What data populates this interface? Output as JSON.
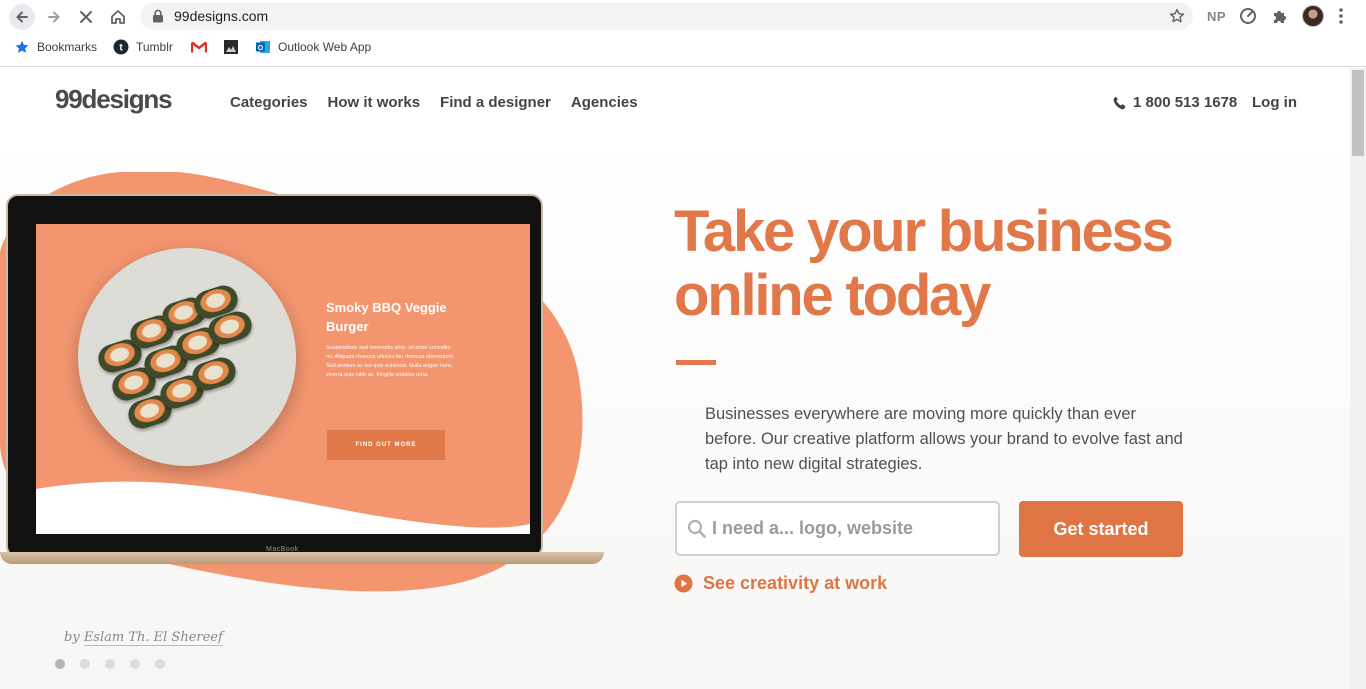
{
  "browser": {
    "url": "99designs.com",
    "profile_initials": "NP",
    "bookmarks": [
      {
        "label": "Bookmarks",
        "icon": "star-icon"
      },
      {
        "label": "Tumblr",
        "icon": "tumblr-icon"
      },
      {
        "label": "",
        "icon": "gmail-icon"
      },
      {
        "label": "",
        "icon": "image-icon"
      },
      {
        "label": "Outlook Web App",
        "icon": "outlook-icon"
      }
    ]
  },
  "site": {
    "logo": "99designs",
    "nav": [
      "Categories",
      "How it works",
      "Find a designer",
      "Agencies"
    ],
    "phone": "1 800 513 1678",
    "login": "Log in"
  },
  "hero": {
    "headline": "Take your business online today",
    "description": "Businesses everywhere are moving more quickly than ever before. Our creative platform allows your brand to evolve fast and tap into new digital strategies.",
    "search_placeholder": "I need a... logo, website",
    "cta": "Get started",
    "creativity_link": "See creativity at work",
    "credit_prefix": "by",
    "credit_name": "Eslam Th. El Shereef",
    "carousel_count": 5,
    "carousel_active": 1
  },
  "mockup": {
    "title": "Smoky BBQ Veggie Burger",
    "body": "Suspendisse sed venenatis ante, sit amet convallis mi. Aliquam rhoncus ultrices leo rhoncus elementum. Sed pretium ac leo quis euismod. Nulla augue nunc, viverra quis nibh ac, fringilla sodales urna.",
    "button": "FIND OUT MORE",
    "device_label": "MacBook"
  },
  "colors": {
    "brand_orange": "#df7444",
    "mockup_orange": "#f39670",
    "text_dark": "#444444"
  }
}
